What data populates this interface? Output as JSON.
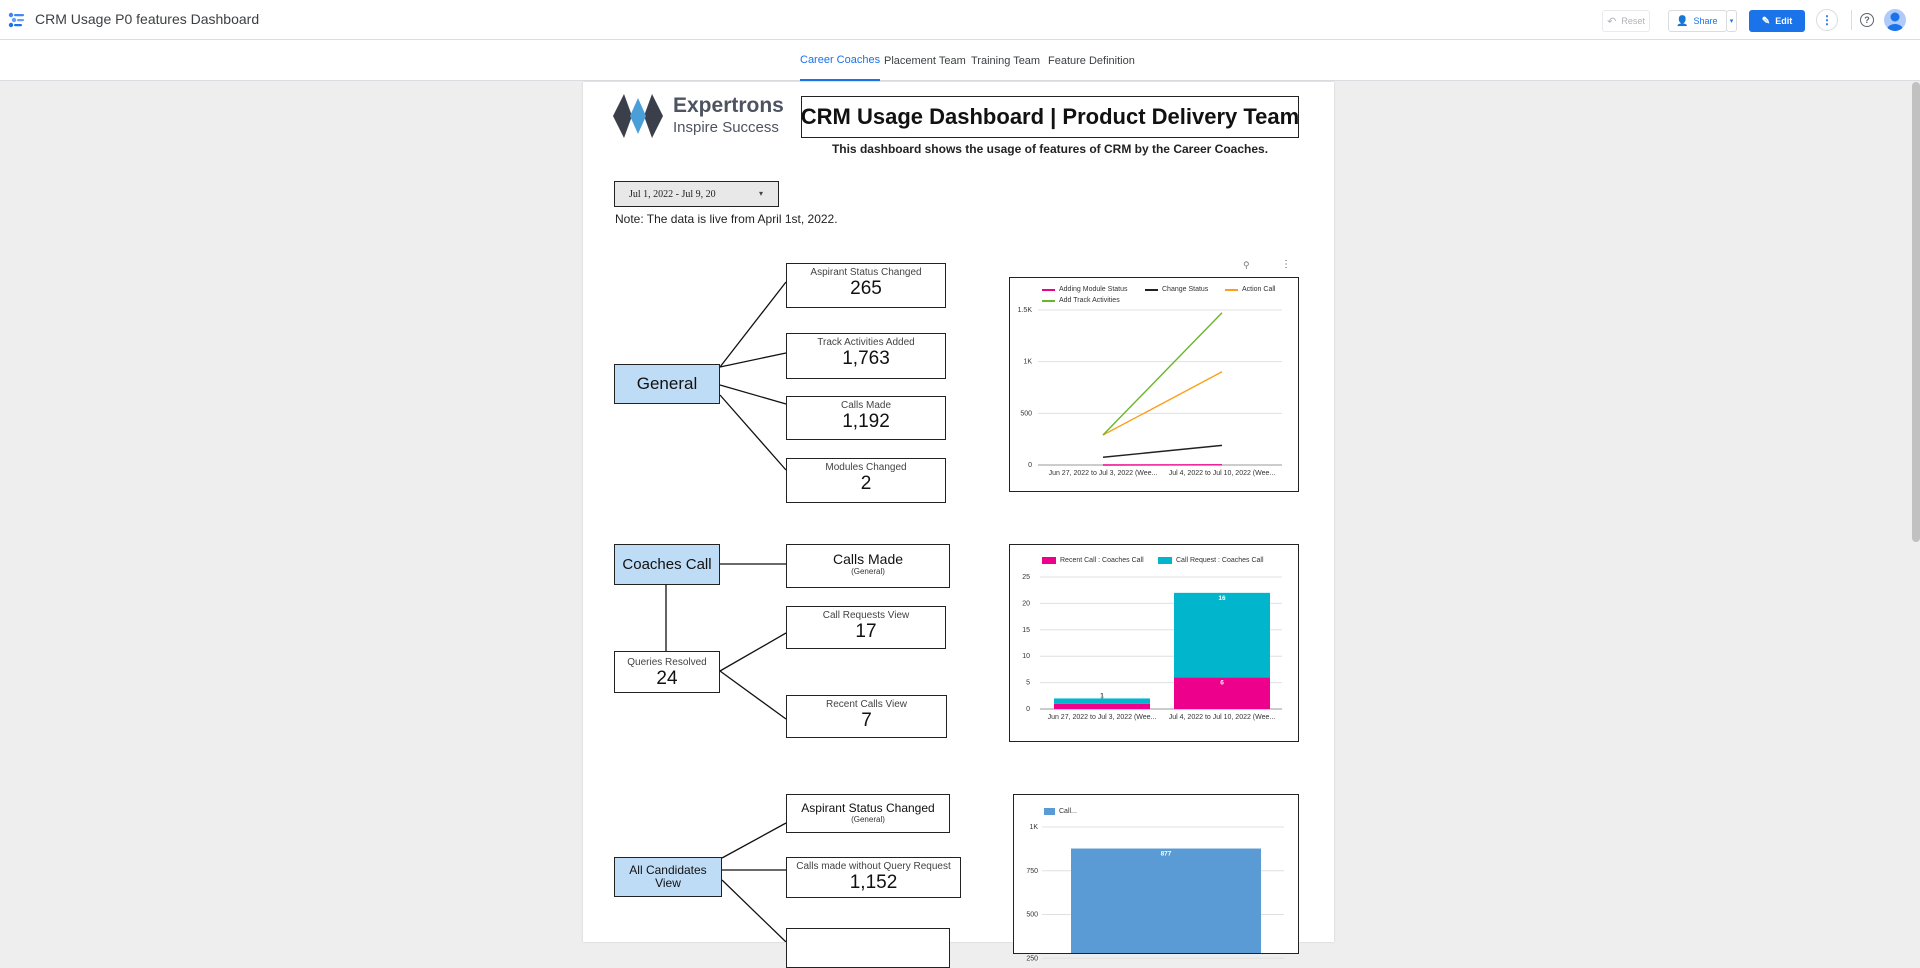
{
  "header": {
    "title": "CRM Usage P0 features Dashboard",
    "reset_label": "Reset",
    "share_label": "Share",
    "edit_label": "Edit"
  },
  "tabs": [
    {
      "label": "Career Coaches",
      "active": true
    },
    {
      "label": "Placement Team",
      "active": false
    },
    {
      "label": "Training Team",
      "active": false
    },
    {
      "label": "Feature Definition",
      "active": false
    }
  ],
  "report": {
    "logo_name": "Expertrons",
    "logo_tagline": "Inspire Success",
    "title": "CRM Usage Dashboard | Product Delivery Team",
    "subtitle": "This dashboard shows the usage of features of CRM by the Career Coaches.",
    "date_range": "Jul 1, 2022 - Jul 9, 20",
    "note": "Note: The data is live from April 1st, 2022."
  },
  "general": {
    "label": "General",
    "metrics": [
      {
        "label": "Aspirant Status Changed",
        "value": "265"
      },
      {
        "label": "Track Activities Added",
        "value": "1,763"
      },
      {
        "label": "Calls Made",
        "value": "1,192"
      },
      {
        "label": "Modules Changed",
        "value": "2"
      }
    ]
  },
  "coaches": {
    "label": "Coaches Call",
    "calls_made": "Calls Made",
    "calls_made_sub": "(General)",
    "queries_label": "Queries Resolved",
    "queries_value": "24",
    "requests_label": "Call Requests View",
    "requests_value": "17",
    "recent_label": "Recent Calls View",
    "recent_value": "7"
  },
  "candidates": {
    "label": "All Candidates View",
    "status_label": "Aspirant Status Changed",
    "status_sub": "(General)",
    "calls_label": "Calls made without Query Request",
    "calls_value": "1,152"
  },
  "colors": {
    "brand_blue": "#1a73e8",
    "category_fill": "#bfdcf6",
    "pink": "#ec008c",
    "teal": "#00b5cc",
    "green": "#6ab52b",
    "orange": "#f9a11b",
    "bar_blue": "#5b9bd5"
  },
  "chart_data": [
    {
      "type": "line",
      "x": [
        "Jun 27, 2022 to Jul 3, 2022 (Wee...",
        "Jul 4, 2022 to Jul 10, 2022 (Wee..."
      ],
      "series": [
        {
          "name": "Adding Module Status",
          "values": [
            0,
            2
          ],
          "color": "#ec008c"
        },
        {
          "name": "Change Status",
          "values": [
            75,
            190
          ],
          "color": "#202124"
        },
        {
          "name": "Action Call",
          "values": [
            290,
            902
          ],
          "color": "#f9a11b"
        },
        {
          "name": "Add Track Activities",
          "values": [
            290,
            1473
          ],
          "color": "#6ab52b"
        }
      ],
      "y_ticks": [
        "0",
        "500",
        "1K",
        "1.5K"
      ],
      "ylim": [
        0,
        1500
      ]
    },
    {
      "type": "bar",
      "stacked": true,
      "categories": [
        "Jun 27, 2022 to Jul 3, 2022 (Wee...",
        "Jul 4, 2022 to Jul 10, 2022 (Wee..."
      ],
      "series": [
        {
          "name": "Recent Call : Coaches Call",
          "values": [
            1,
            6
          ],
          "color": "#ec008c"
        },
        {
          "name": "Call Request : Coaches Call",
          "values": [
            1,
            16
          ],
          "color": "#00b5cc"
        }
      ],
      "y_ticks": [
        "0",
        "5",
        "10",
        "15",
        "20",
        "25"
      ],
      "ylim": [
        0,
        25
      ]
    },
    {
      "type": "bar",
      "categories": [
        ""
      ],
      "series": [
        {
          "name": "Call...",
          "values": [
            877
          ],
          "color": "#5b9bd5"
        }
      ],
      "y_ticks": [
        "250",
        "500",
        "750",
        "1K"
      ],
      "ylim": [
        0,
        1000
      ]
    }
  ]
}
